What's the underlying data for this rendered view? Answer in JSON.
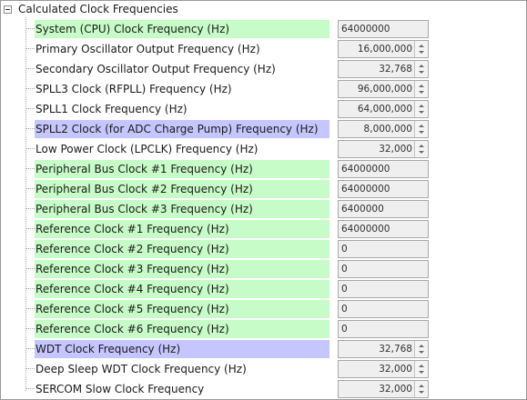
{
  "header": {
    "title": "Calculated Clock Frequencies"
  },
  "rows": [
    {
      "label": "System (CPU) Clock Frequency (Hz)",
      "value": "64000000",
      "kind": "text",
      "highlight": "green"
    },
    {
      "label": "Primary Oscillator Output Frequency (Hz)",
      "value": "16,000,000",
      "kind": "number",
      "highlight": "none"
    },
    {
      "label": "Secondary Oscillator Output Frequency (Hz)",
      "value": "32,768",
      "kind": "number",
      "highlight": "none"
    },
    {
      "label": "SPLL3 Clock (RFPLL) Frequency (Hz)",
      "value": "96,000,000",
      "kind": "number",
      "highlight": "none"
    },
    {
      "label": "SPLL1 Clock Frequency (Hz)",
      "value": "64,000,000",
      "kind": "number",
      "highlight": "none"
    },
    {
      "label": "SPLL2 Clock (for ADC Charge Pump) Frequency (Hz)",
      "value": "8,000,000",
      "kind": "number",
      "highlight": "purple"
    },
    {
      "label": "Low Power Clock (LPCLK) Frequency (Hz)",
      "value": "32,000",
      "kind": "number",
      "highlight": "none"
    },
    {
      "label": "Peripheral Bus Clock #1 Frequency (Hz)",
      "value": "64000000",
      "kind": "text",
      "highlight": "green"
    },
    {
      "label": "Peripheral Bus Clock #2 Frequency (Hz)",
      "value": "64000000",
      "kind": "text",
      "highlight": "green"
    },
    {
      "label": "Peripheral Bus Clock #3 Frequency (Hz)",
      "value": "6400000",
      "kind": "text",
      "highlight": "green"
    },
    {
      "label": "Reference Clock #1 Frequency (Hz)",
      "value": "64000000",
      "kind": "text",
      "highlight": "green"
    },
    {
      "label": "Reference Clock #2 Frequency (Hz)",
      "value": "0",
      "kind": "text",
      "highlight": "green"
    },
    {
      "label": "Reference Clock #3 Frequency (Hz)",
      "value": "0",
      "kind": "text",
      "highlight": "green"
    },
    {
      "label": "Reference Clock #4 Frequency (Hz)",
      "value": "0",
      "kind": "text",
      "highlight": "green"
    },
    {
      "label": "Reference Clock #5 Frequency (Hz)",
      "value": "0",
      "kind": "text",
      "highlight": "green"
    },
    {
      "label": "Reference Clock #6 Frequency (Hz)",
      "value": "0",
      "kind": "text",
      "highlight": "green"
    },
    {
      "label": "WDT Clock Frequency (Hz)",
      "value": "32,768",
      "kind": "number",
      "highlight": "purple"
    },
    {
      "label": "Deep Sleep WDT Clock Frequency (Hz)",
      "value": "32,000",
      "kind": "number",
      "highlight": "none"
    },
    {
      "label": "SERCOM Slow Clock Frequency",
      "value": "32,000",
      "kind": "number",
      "highlight": "none"
    }
  ],
  "colors": {
    "highlight_green": "#c7fbc7",
    "highlight_purple": "#c6c6ff",
    "field_background": "#efefef",
    "panel_border": "#9a9a9a"
  },
  "icons": {
    "expander": "tree-collapse-minus-icon",
    "spinner": "spin-up-down-arrows-icon"
  }
}
